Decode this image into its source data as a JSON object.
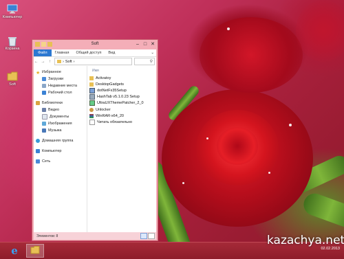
{
  "desktop": {
    "icons": [
      {
        "label": "Компьютер",
        "icon": "computer-icon"
      },
      {
        "label": "Корзина",
        "icon": "recycle-bin-icon"
      },
      {
        "label": "Soft",
        "icon": "folder-icon"
      }
    ]
  },
  "window": {
    "title": "Soft",
    "ribbon_tabs": {
      "file": "Файл",
      "home": "Главная",
      "share": "Общий доступ",
      "view": "Вид"
    },
    "address": {
      "path": "Soft",
      "separator": "›"
    },
    "nav_pane": {
      "favorites": "Избранное",
      "favorites_items": [
        "Загрузки",
        "Недавние места",
        "Рабочий стол"
      ],
      "libraries": "Библиотеки",
      "libraries_items": [
        "Видео",
        "Документы",
        "Изображения",
        "Музыка"
      ],
      "homegroup": "Домашняя группа",
      "computer": "Компьютер",
      "network": "Сеть"
    },
    "file_pane": {
      "column_name": "Имя",
      "files": [
        {
          "name": "Activatoy",
          "icon": "folder-icon"
        },
        {
          "name": "DesktopGadgets",
          "icon": "folder-icon"
        },
        {
          "name": "dotNetFx35Setup",
          "icon": "installer-icon"
        },
        {
          "name": "HashTab v5.1.0.23 Setup",
          "icon": "installer-icon"
        },
        {
          "name": "UltraUXThemePatcher_2_0",
          "icon": "installer-icon"
        },
        {
          "name": "Unlocker",
          "icon": "unlocker-icon"
        },
        {
          "name": "WinRAR-x64_20",
          "icon": "winrar-icon"
        },
        {
          "name": "Читать обязательно",
          "icon": "text-file-icon"
        }
      ]
    },
    "status": "Элементов: 8"
  },
  "taskbar": {
    "clock_date": "02.02.2013"
  },
  "watermark": "kazachya.net",
  "colors": {
    "window_frame": "#f4aeb8",
    "file_tab": "#2b78d1",
    "taskbar": "#9a2232",
    "folder": "#e8c055"
  }
}
